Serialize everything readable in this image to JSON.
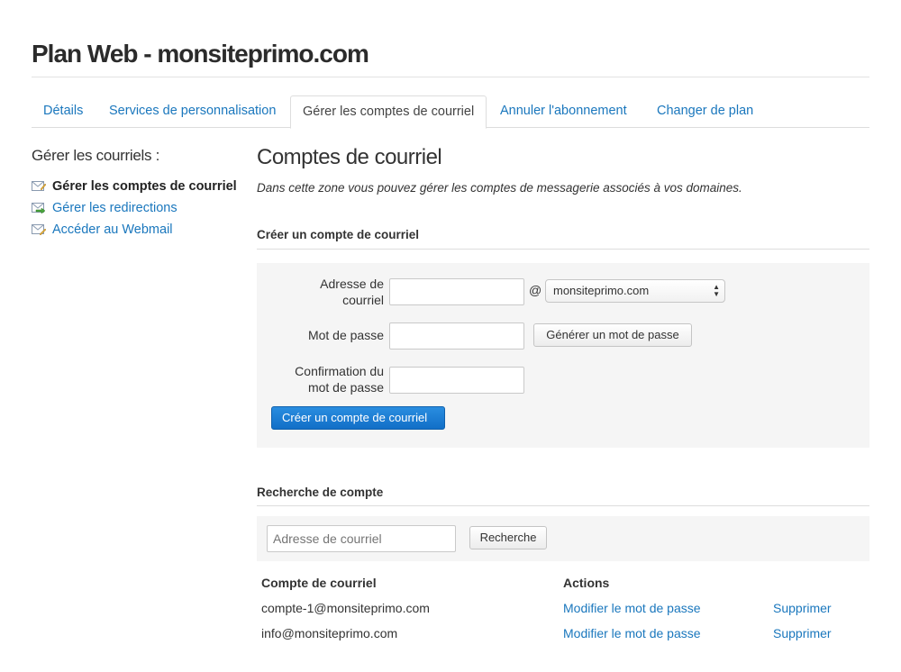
{
  "page": {
    "title": "Plan Web - monsiteprimo.com"
  },
  "tabs": [
    {
      "label": "Détails",
      "active": false
    },
    {
      "label": "Services de personnalisation",
      "active": false
    },
    {
      "label": "Gérer les comptes de courriel",
      "active": true
    },
    {
      "label": "Annuler l'abonnement",
      "active": false
    },
    {
      "label": "Changer de plan",
      "active": false
    }
  ],
  "sidebar": {
    "title": "Gérer les courriels :",
    "items": [
      {
        "label": "Gérer les comptes de courriel",
        "icon": "mail-edit-icon",
        "current": true
      },
      {
        "label": "Gérer les redirections",
        "icon": "mail-forward-icon",
        "current": false
      },
      {
        "label": "Accéder au Webmail",
        "icon": "webmail-icon",
        "current": false
      }
    ]
  },
  "main": {
    "title": "Comptes de courriel",
    "description": "Dans cette zone vous pouvez gérer les comptes de messagerie associés à vos domaines."
  },
  "create_form": {
    "section_title": "Créer un compte de courriel",
    "address_label_line1": "Adresse de",
    "address_label_line2": "courriel",
    "address_value": "",
    "at_sign": "@",
    "domain_selected": "monsiteprimo.com",
    "password_label": "Mot de passe",
    "password_value": "",
    "generate_button": "Générer un mot de passe",
    "confirm_label_line1": "Confirmation du",
    "confirm_label_line2": "mot de passe",
    "confirm_value": "",
    "submit_button": "Créer un compte de courriel"
  },
  "search": {
    "section_title": "Recherche de compte",
    "placeholder": "Adresse de courriel",
    "button": "Recherche"
  },
  "accounts_table": {
    "headers": {
      "account": "Compte de courriel",
      "actions": "Actions"
    },
    "rows": [
      {
        "email": "compte-1@monsiteprimo.com",
        "change_password": "Modifier le mot de passe",
        "delete": "Supprimer"
      },
      {
        "email": "info@monsiteprimo.com",
        "change_password": "Modifier le mot de passe",
        "delete": "Supprimer"
      }
    ]
  },
  "colors": {
    "link": "#1a77bd",
    "primary_button": "#1a7fd4",
    "panel_bg": "#f5f5f5"
  }
}
